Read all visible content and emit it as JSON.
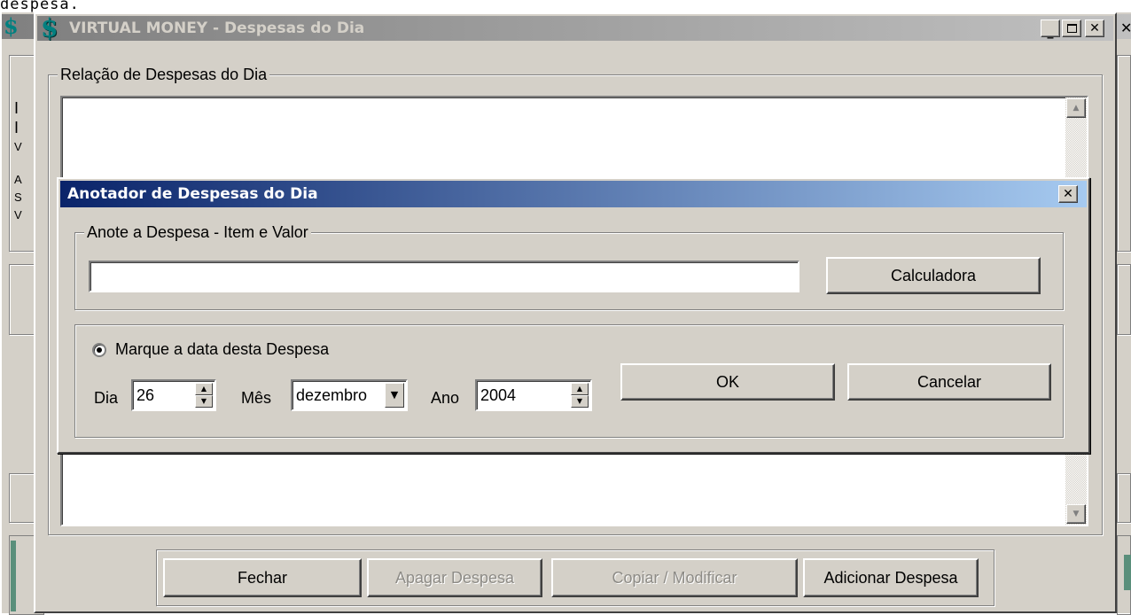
{
  "top_text": "despesa.",
  "main_window": {
    "title": "VIRTUAL MONEY - Despesas do Dia",
    "app_icon": "dollar-sign-icon",
    "titlebar_colors": {
      "start": "#808080",
      "end": "#c0c0c0"
    },
    "group_label": "Relação de Despesas do Dia",
    "buttons": {
      "close": "Fechar",
      "delete": "Apagar Despesa",
      "copy_modify": "Copiar / Modificar",
      "add": "Adicionar Despesa"
    }
  },
  "background_window": {
    "left_edge_letters": [
      "I",
      "I",
      "V",
      "A",
      "S",
      "V"
    ]
  },
  "dialog": {
    "title": "Anotador de Despesas do Dia",
    "titlebar_colors": {
      "start": "#0a246a",
      "end": "#a6caf0"
    },
    "item_group_label": "Anote a Despesa - Item e Valor",
    "item_input_value": "",
    "calculator_button": "Calculadora",
    "date_radio_label": "Marque a data desta Despesa",
    "date_radio_checked": true,
    "day_label": "Dia",
    "day_value": "26",
    "month_label": "Mês",
    "month_value": "dezembro",
    "year_label": "Ano",
    "year_value": "2004",
    "ok_button": "OK",
    "cancel_button": "Cancelar"
  },
  "colors": {
    "face": "#d4d0c8",
    "disabled_text": "#8d8b86"
  }
}
